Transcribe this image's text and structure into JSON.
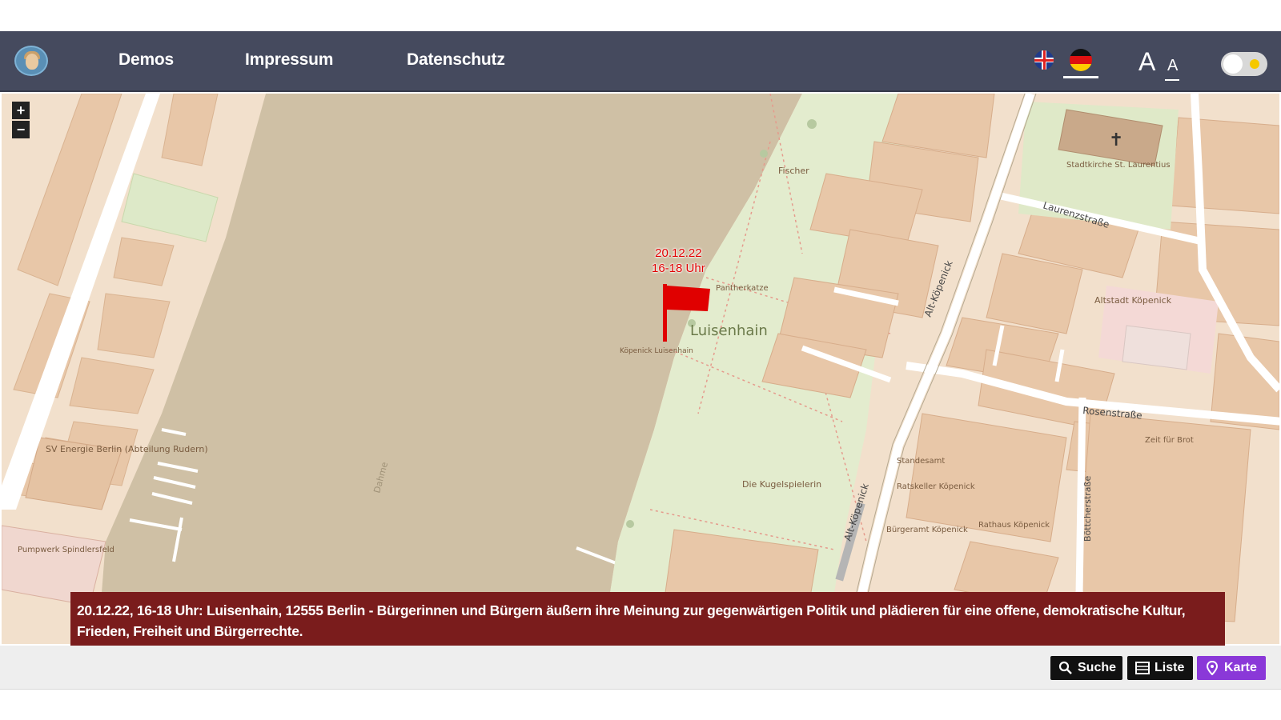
{
  "nav": {
    "links": [
      "Demos",
      "Impressum",
      "Datenschutz"
    ],
    "languages": [
      "english-flag",
      "german-flag"
    ],
    "active_language": "german-flag",
    "font_size_large": "A",
    "font_size_small": "A"
  },
  "map": {
    "zoom_in": "+",
    "zoom_out": "−",
    "marker_label_date": "20.12.22",
    "marker_label_time": "16-18 Uhr",
    "place_labels": {
      "luisenhain": "Luisenhain",
      "fischer": "Fischer",
      "panther": "Pantherkatze",
      "kugelspielerin": "Die Kugelspielerin",
      "stadtkirche": "Stadtkirche St. Laurentius",
      "altstadt": "Altstadt Köpenick",
      "laurenzstrasse": "Laurenzstraße",
      "rosenstrasse": "Rosenstraße",
      "alt_koepenick": "Alt-Köpenick",
      "boetzowstrasse": "Böttcherstraße",
      "rathaus": "Rathaus Köpenick",
      "energie": "SV Energie Berlin (Abteilung Rudern)",
      "pumpwerk": "Pumpwerk Spindlersfeld",
      "dahme": "Dahme",
      "koepenick_luisenhain": "Köpenick Luisenhain",
      "zeit_fuer_brot": "Zeit für Brot",
      "bürgeramt": "Bürgeramt Köpenick",
      "ratskeller": "Ratskeller Köpenick",
      "standesamt": "Standesamt"
    }
  },
  "banner": {
    "text": "20.12.22, 16-18 Uhr: Luisenhain, 12555 Berlin - Bürgerinnen und Bürgern äußern ihre Meinung zur gegenwärtigen Politik und plädieren für eine offene, demokratische Kultur, Frieden, Freiheit und Bürgerrechte."
  },
  "buttons": {
    "search": "Suche",
    "list": "Liste",
    "map": "Karte"
  },
  "colors": {
    "navbar": "#454a5e",
    "banner": "#7a1c1c",
    "karte_button": "#8a38d8",
    "marker": "#e00000",
    "water": "#cdbfa4",
    "park": "#e3eccd"
  }
}
